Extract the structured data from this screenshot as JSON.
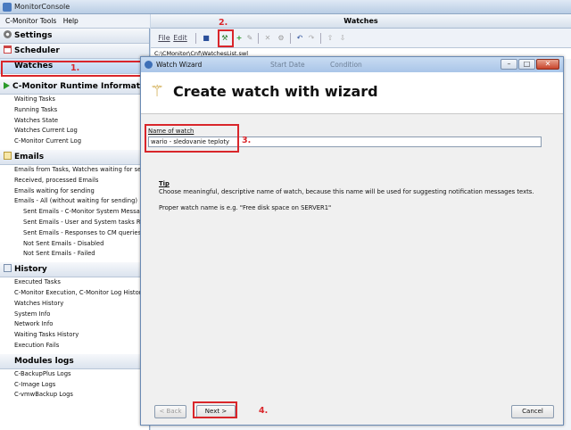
{
  "app": {
    "title": "MonitorConsole"
  },
  "menu": {
    "items": [
      "C-Monitor Tools",
      "Help"
    ]
  },
  "sidebar": {
    "settings": "Settings",
    "scheduler": "Scheduler",
    "watches": "Watches",
    "runtime": {
      "title": "C-Monitor Runtime Information's",
      "items": [
        "Waiting Tasks",
        "Running Tasks",
        "Watches State",
        "Watches Current Log",
        "C-Monitor Current Log"
      ]
    },
    "emails": {
      "title": "Emails",
      "items": [
        "Emails from Tasks, Watches waiting for sending",
        "Received, processed Emails",
        "Emails waiting for sending",
        "Emails - All (without waiting for sending)"
      ],
      "subitems": [
        "Sent Emails - C-Monitor System Messages",
        "Sent Emails - User and System tasks Results",
        "Sent Emails - Responses to CM queries",
        "Not Sent Emails - Disabled",
        "Not Sent Emails - Failed"
      ]
    },
    "history": {
      "title": "History",
      "items": [
        "Executed Tasks",
        "C-Monitor Execution, C-Monitor Log History",
        "Watches History",
        "System Info",
        "Network Info",
        "Waiting Tasks History",
        "Execution Fails"
      ]
    },
    "modules": {
      "title": "Modules logs",
      "items": [
        "C-BackupPlus Logs",
        "C-Image Logs",
        "C-vmwBackup Logs"
      ]
    }
  },
  "main": {
    "header": "Watches",
    "toolbar": {
      "file": "File",
      "edit": "Edit"
    },
    "path": "C:\\CMonitor\\Cnf\\WatchesList.swl",
    "col_headers": [
      "Start Date",
      "Condition"
    ]
  },
  "wizard": {
    "window_title": "Watch Wizard",
    "heading": "Create watch with wizard",
    "name_label": "Name of watch",
    "name_value": "wario - sledovanie teploty",
    "tip_title": "Tip",
    "tip_text": "Choose meaningful, descriptive name of watch, because this name will be used for suggesting notification messages texts.",
    "example_text": "Proper watch name is e.g. \"Free disk space on SERVER1\"",
    "back_label": "< Back",
    "next_label": "Next >",
    "cancel_label": "Cancel"
  },
  "annotations": {
    "step1": "1.",
    "step2": "2.",
    "step3": "3.",
    "step4": "4."
  },
  "colors": {
    "accent_red": "#d9262b",
    "selection": "#bcd3f0",
    "titlebar": "#b9cde4"
  }
}
